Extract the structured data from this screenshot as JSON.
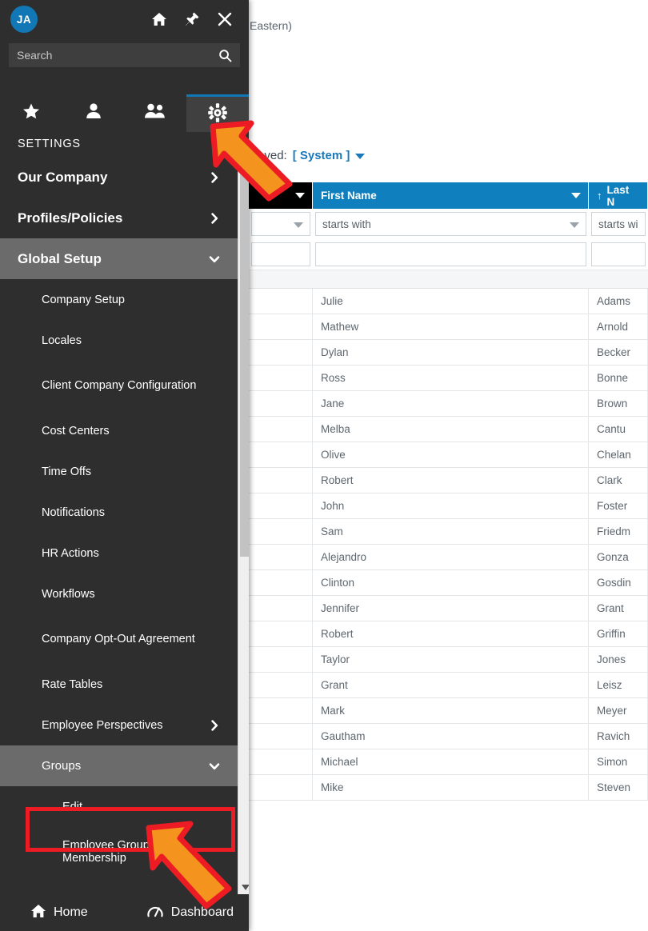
{
  "app": {
    "timezone_note": "Eastern)",
    "saved_label": "Saved:",
    "saved_value": "[ System ]"
  },
  "flyout": {
    "avatar_initials": "JA",
    "top_icons": [
      {
        "name": "home-icon",
        "label": "Home"
      },
      {
        "name": "pin-icon",
        "label": "Pin"
      },
      {
        "name": "close-icon",
        "label": "Close"
      }
    ],
    "search": {
      "value": "Search",
      "placeholder": "Search",
      "icon": "search-icon"
    },
    "tabs": [
      {
        "name": "favorites",
        "icon": "star-icon",
        "active": false
      },
      {
        "name": "my-info",
        "icon": "person-icon",
        "active": false
      },
      {
        "name": "people",
        "icon": "people-icon",
        "active": false
      },
      {
        "name": "settings",
        "icon": "gear-icon",
        "active": true
      }
    ],
    "section_title": "SETTINGS",
    "menu": [
      {
        "label": "Our Company",
        "level": 1,
        "chevron": "right",
        "state": "closed"
      },
      {
        "label": "Profiles/Policies",
        "level": 1,
        "chevron": "right",
        "state": "closed"
      },
      {
        "label": "Global Setup",
        "level": 1,
        "chevron": "down",
        "state": "open"
      },
      {
        "label": "Company Setup",
        "level": 2,
        "chevron": "none",
        "state": "normal"
      },
      {
        "label": "Locales",
        "level": 2,
        "chevron": "none",
        "state": "normal"
      },
      {
        "label": "Client Company Configuration",
        "level": 2,
        "chevron": "none",
        "state": "normal",
        "two_line": true
      },
      {
        "label": "Cost Centers",
        "level": 2,
        "chevron": "none",
        "state": "normal"
      },
      {
        "label": "Time Offs",
        "level": 2,
        "chevron": "none",
        "state": "normal"
      },
      {
        "label": "Notifications",
        "level": 2,
        "chevron": "none",
        "state": "normal"
      },
      {
        "label": "HR Actions",
        "level": 2,
        "chevron": "none",
        "state": "normal"
      },
      {
        "label": "Workflows",
        "level": 2,
        "chevron": "none",
        "state": "normal"
      },
      {
        "label": "Company Opt-Out Agreement",
        "level": 2,
        "chevron": "none",
        "state": "normal",
        "two_line": true
      },
      {
        "label": "Rate Tables",
        "level": 2,
        "chevron": "none",
        "state": "normal"
      },
      {
        "label": "Employee Perspectives",
        "level": 2,
        "chevron": "right",
        "state": "normal"
      },
      {
        "label": "Groups",
        "level": 2,
        "chevron": "down",
        "state": "open"
      },
      {
        "label": "Edit",
        "level": 3,
        "chevron": "none",
        "state": "highlighted"
      },
      {
        "label": "Employee Group Membership",
        "level": 3,
        "chevron": "none",
        "state": "normal",
        "two_line": true
      }
    ],
    "footer": [
      {
        "label": "Home",
        "icon": "home-icon"
      },
      {
        "label": "Dashboard",
        "icon": "dashboard-icon"
      }
    ],
    "scrollbar": {
      "up_arrow": "scroll-up-icon",
      "down_arrow": "scroll-down-icon"
    }
  },
  "grid": {
    "columns": [
      {
        "key": "select",
        "header": "",
        "sorted": "none",
        "filter_operator": "",
        "filter_value": "",
        "style": "dark"
      },
      {
        "key": "first_name",
        "header": "First Name",
        "sorted": "none",
        "filter_operator": "starts with",
        "filter_value": ""
      },
      {
        "key": "last_name",
        "header": "Last N",
        "sorted": "asc",
        "filter_operator": "starts wi",
        "filter_value": ""
      }
    ],
    "sort_asc_glyph": "↑",
    "rows": [
      {
        "select": "",
        "first_name": "Julie",
        "last_name": "Adams"
      },
      {
        "select": "",
        "first_name": "Mathew",
        "last_name": "Arnold"
      },
      {
        "select": "",
        "first_name": "Dylan",
        "last_name": "Becker"
      },
      {
        "select": "",
        "first_name": "Ross",
        "last_name": "Bonne"
      },
      {
        "select": "",
        "first_name": "Jane",
        "last_name": "Brown"
      },
      {
        "select": "",
        "first_name": "Melba",
        "last_name": "Cantu"
      },
      {
        "select": "",
        "first_name": "Olive",
        "last_name": "Chelan"
      },
      {
        "select": "",
        "first_name": "Robert",
        "last_name": "Clark"
      },
      {
        "select": "",
        "first_name": "John",
        "last_name": "Foster"
      },
      {
        "select": "",
        "first_name": "Sam",
        "last_name": "Friedm"
      },
      {
        "select": "",
        "first_name": "Alejandro",
        "last_name": "Gonza"
      },
      {
        "select": "",
        "first_name": "Clinton",
        "last_name": "Gosdin"
      },
      {
        "select": "",
        "first_name": "Jennifer",
        "last_name": "Grant"
      },
      {
        "select": "",
        "first_name": "Robert",
        "last_name": "Griffin"
      },
      {
        "select": "",
        "first_name": "Taylor",
        "last_name": "Jones"
      },
      {
        "select": "",
        "first_name": "Grant",
        "last_name": "Leisz"
      },
      {
        "select": "",
        "first_name": "Mark",
        "last_name": "Meyer"
      },
      {
        "select": "",
        "first_name": "Gautham",
        "last_name": "Ravich"
      },
      {
        "select": "",
        "first_name": "Michael",
        "last_name": "Simon"
      },
      {
        "select": "",
        "first_name": "Mike",
        "last_name": "Steven"
      }
    ]
  },
  "annotations": {
    "highlight_box_color": "#ed1c24",
    "arrow_color": "#f4941e",
    "arrow_outline_color": "#ed1c24",
    "arrows": [
      {
        "name": "arrow-pointing-to-gear-tab",
        "target": "gear-icon"
      },
      {
        "name": "arrow-pointing-to-edit-item",
        "target": "menu-item-edit"
      }
    ],
    "highlighted_item": "Edit"
  }
}
